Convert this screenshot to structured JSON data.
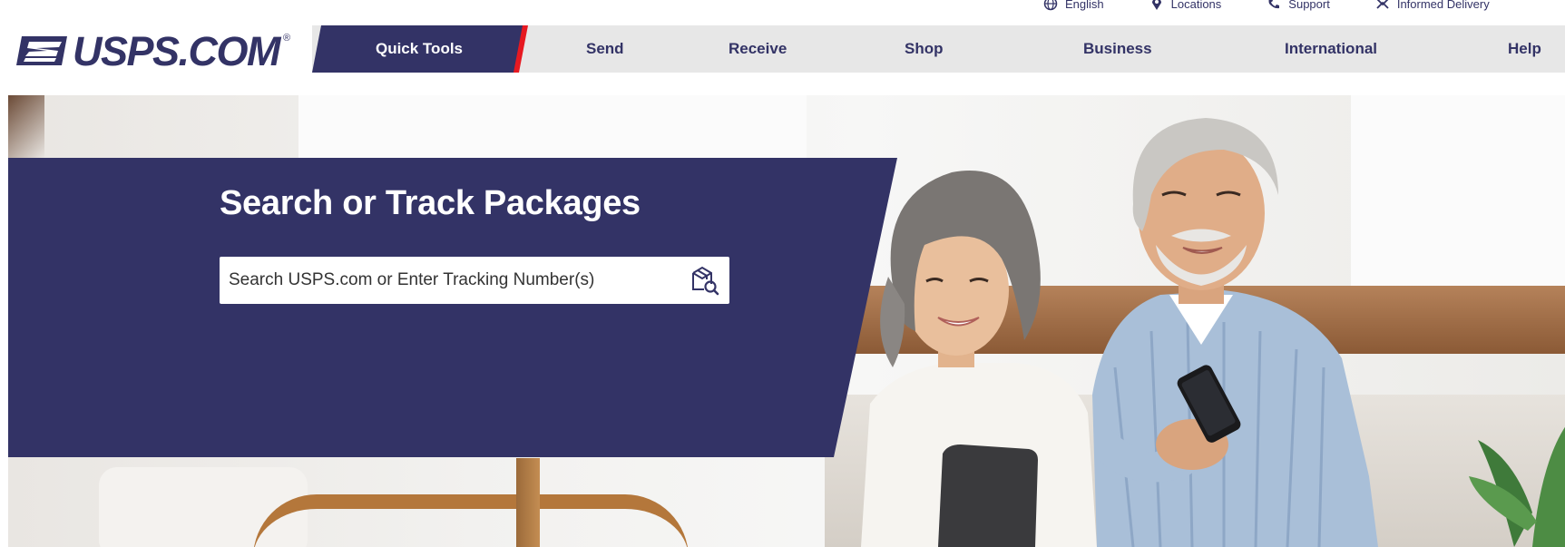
{
  "utility": {
    "items": [
      {
        "label": "English",
        "icon": "globe-icon"
      },
      {
        "label": "Locations",
        "icon": "location-pin-icon"
      },
      {
        "label": "Support",
        "icon": "phone-icon"
      },
      {
        "label": "Informed Delivery",
        "icon": "informed-delivery-icon"
      }
    ]
  },
  "logo": {
    "text": "USPS.COM",
    "reg": "®"
  },
  "nav": {
    "quick_tools": "Quick Tools",
    "items": [
      "Send",
      "Receive",
      "Shop",
      "Business",
      "International",
      "Help"
    ]
  },
  "hero": {
    "title": "Search or Track Packages",
    "search_placeholder": "Search USPS.com or Enter Tracking Number(s)",
    "search_icon": "package-search-icon"
  },
  "colors": {
    "brand_navy": "#333366",
    "accent_red": "#e71921",
    "nav_bg": "#e7e7e7"
  }
}
